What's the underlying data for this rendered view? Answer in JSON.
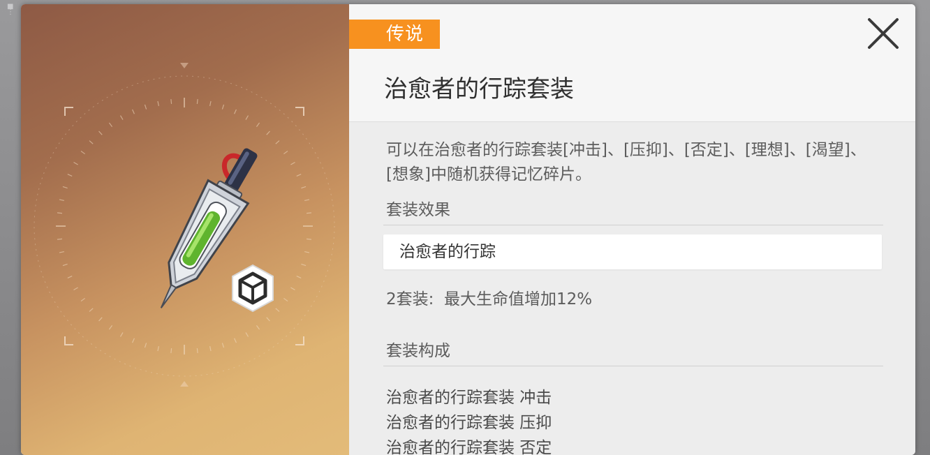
{
  "rarity": {
    "label": "传说",
    "color": "#f7911f"
  },
  "item": {
    "title": "治愈者的行踪套装",
    "description": "可以在治愈者的行踪套装[冲击]、[压抑]、[否定]、[理想]、[渴望]、[想象]中随机获得记忆碎片。"
  },
  "set_effect": {
    "heading": "套装效果",
    "name": "治愈者的行踪",
    "bonus_label": "2套装:",
    "bonus_text": "最大生命值增加12%"
  },
  "set_components": {
    "heading": "套装构成",
    "items": [
      "治愈者的行踪套装 冲击",
      "治愈者的行踪套装 压抑",
      "治愈者的行踪套装 否定"
    ]
  },
  "icons": {
    "close": "close-x-icon",
    "type_badge": "cube-hexagon-icon",
    "item_art": "syringe-vial-icon"
  },
  "colors": {
    "art_gradient_start": "#8e5a45",
    "art_gradient_end": "#e3bb79",
    "panel_bg": "#ededed",
    "header_bg": "#f6f6f6"
  }
}
